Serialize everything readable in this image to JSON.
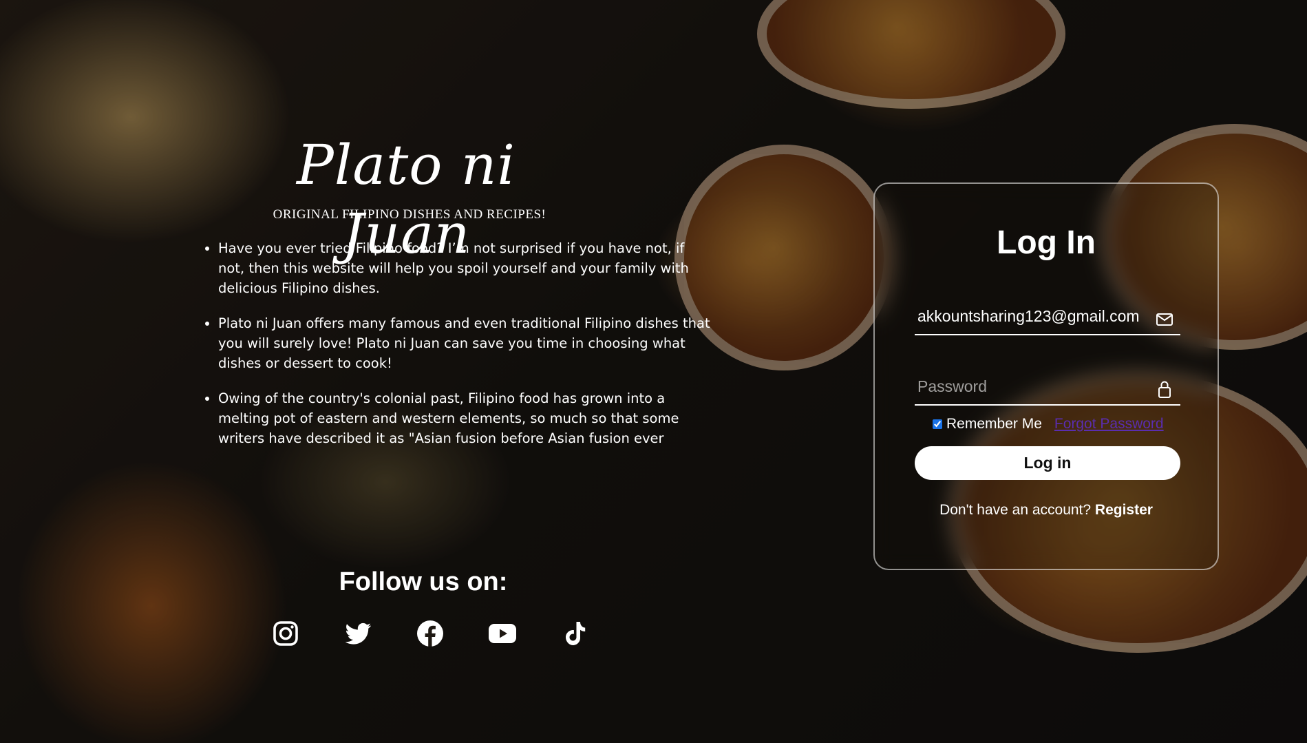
{
  "brand": {
    "title": "Plato ni Juan",
    "tagline": "ORIGINAL FILIPINO DISHES AND RECIPES!"
  },
  "features": [
    "Have you ever tried Filipino food? I’m not surprised if you have not, if not, then this website will help you spoil yourself and your family with delicious Filipino dishes.",
    "Plato ni Juan offers many famous and even traditional Filipino dishes that you will surely love! Plato ni Juan can save you time in choosing what dishes or dessert to cook!",
    "Owing of the country's colonial past, Filipino food has grown into a melting pot of eastern and western elements, so much so that some writers have described it as \"Asian fusion before Asian fusion ever"
  ],
  "follow": {
    "title": "Follow us on:",
    "icons": [
      "instagram-icon",
      "twitter-icon",
      "facebook-icon",
      "youtube-icon",
      "tiktok-icon"
    ]
  },
  "login": {
    "title": "Log In",
    "email_value": "akkountsharing123@gmail.com",
    "email_icon": "envelope-icon",
    "password_placeholder": "Password",
    "password_icon": "lock-icon",
    "remember_label": "Remember Me",
    "remember_checked": true,
    "forgot_label": "Forgot Password",
    "button_label": "Log in",
    "register_prompt": "Don't have an account?",
    "register_link": "Register"
  },
  "colors": {
    "text": "#ffffff",
    "button_bg": "#ffffff",
    "forgot_link": "#5a2db0",
    "checkbox": "#1a73e8"
  }
}
